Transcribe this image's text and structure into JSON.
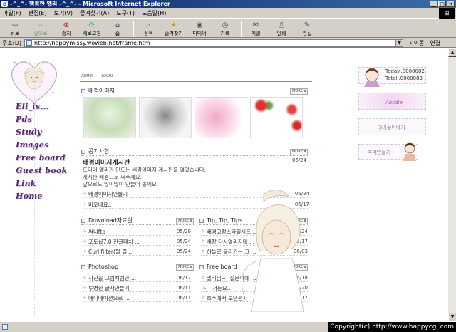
{
  "window": {
    "title": "-^_^- 행복한 엘리 -^_^- - Microsoft Internet Explorer"
  },
  "menu": [
    "파일(F)",
    "편집(E)",
    "보기(V)",
    "즐겨찾기(A)",
    "도구(T)",
    "도움말(H)"
  ],
  "toolbar": [
    {
      "label": "뒤로",
      "icon": "back-arrow-icon"
    },
    {
      "label": "앞으로",
      "icon": "forward-arrow-icon"
    },
    {
      "label": "중지",
      "icon": "stop-icon"
    },
    {
      "label": "새로고침",
      "icon": "refresh-icon"
    },
    {
      "label": "홈",
      "icon": "home-icon"
    },
    {
      "label": "검색",
      "icon": "search-icon"
    },
    {
      "label": "즐겨찾기",
      "icon": "favorites-icon"
    },
    {
      "label": "미디어",
      "icon": "media-icon"
    },
    {
      "label": "기록",
      "icon": "history-icon"
    },
    {
      "label": "메일",
      "icon": "mail-icon"
    },
    {
      "label": "인쇄",
      "icon": "print-icon"
    },
    {
      "label": "편집",
      "icon": "edit-icon"
    }
  ],
  "address": {
    "label": "주소(D)",
    "url": "http://happymissy.woweb.net/frame.htm",
    "go_label": "이동",
    "links_label": "연결"
  },
  "site": {
    "nav": [
      "Eli_is...",
      "Pds",
      "Study",
      "Images",
      "Free board",
      "Guest book",
      "Link",
      "Home"
    ],
    "top_links": [
      "ADMIN",
      "LOGIN"
    ],
    "more_label": "MORE",
    "sections": {
      "bg_images": {
        "title": "배경이미지"
      },
      "notice": {
        "title": "공지사항",
        "headline": "배경이미지게시판",
        "headline_date": "06/24",
        "body": [
          "드디어 엘리가 만드는 배경이미지 게시판을 열었습니다.",
          "게시판 배경으로 써주세요.",
          "앞으로도 많이많이 만들어 볼께요."
        ],
        "items": [
          {
            "title": "배경이미지만들기",
            "date": "06/24"
          },
          {
            "title": "비오네요..",
            "date": "06/17"
          }
        ]
      },
      "download": {
        "title": "Download자료실",
        "items": [
          {
            "title": "써니ftp",
            "date": "05/29"
          },
          {
            "title": "포토샵7.0 한글패치 ...",
            "date": "05/24"
          },
          {
            "title": "Curl filter(펄 필 ...",
            "date": "05/24"
          }
        ]
      },
      "tip": {
        "title": "Tip, Tip, Tips",
        "items": [
          {
            "title": "배경고정스타일시트 ...",
            "date": "06/24"
          },
          {
            "title": "새창 다시열리지않 ...",
            "date": "06/17"
          },
          {
            "title": "하늘로 올라가는 그 ...",
            "date": "06/03"
          }
        ]
      },
      "photoshop": {
        "title": "Photoshop",
        "items": [
          {
            "title": "사진을 그림처럼만 ...",
            "date": "06/17"
          },
          {
            "title": "투명한 글자만들기",
            "date": "06/11"
          },
          {
            "title": "애니메이션으로 ...",
            "date": "06/11"
          }
        ]
      },
      "freeboard": {
        "title": "Free board",
        "items": [
          {
            "title": "엘리님~! 질문이에 ...",
            "date": "06/18"
          },
          {
            "title": "저는요..",
            "date": "06/20"
          },
          {
            "title": "호주에서 보낸편지",
            "date": "06/17"
          }
        ]
      }
    },
    "right": {
      "today_label": "Today..0000002",
      "total_label": "Total..0000083",
      "banner_text": "Abcdle",
      "diary_label": "아이들이야기",
      "memory_label": "추억만들기"
    }
  },
  "status": {
    "copyright": "Copyright(c) http://www.happycgi.com"
  },
  "colors": {
    "title_bar": "#0a246a",
    "nav_text": "#5a2a6a",
    "accent": "#9a7ab0"
  }
}
